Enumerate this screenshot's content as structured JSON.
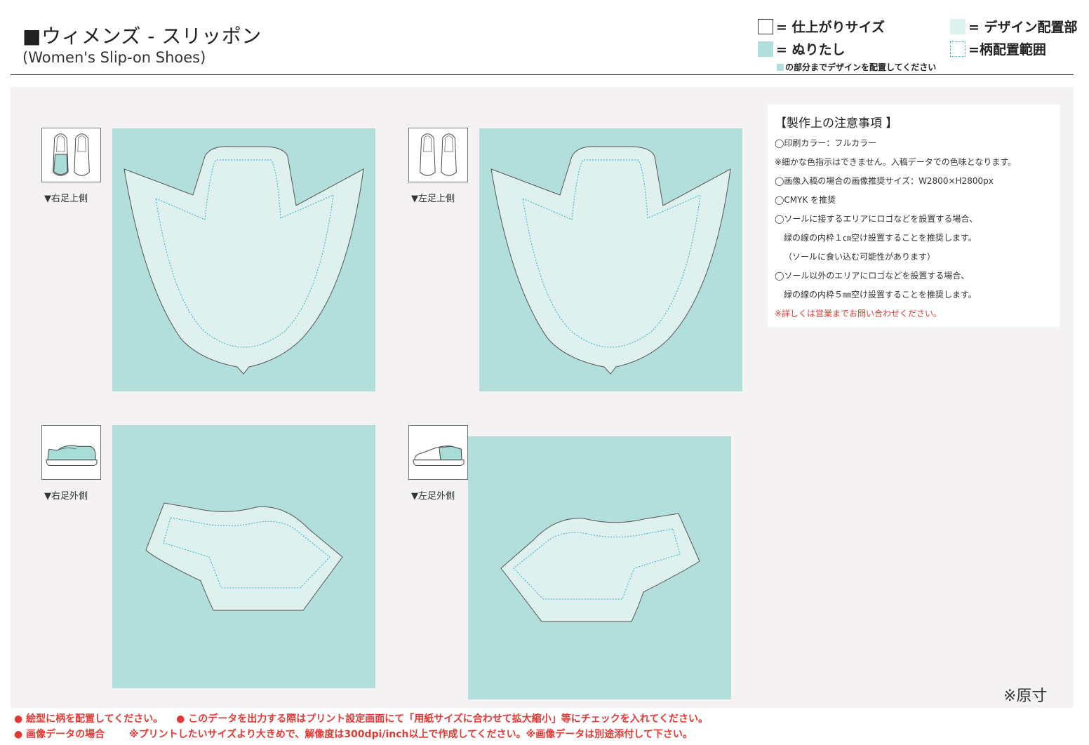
{
  "header": {
    "title": "■ウィメンズ - スリッポン",
    "subtitle": "(Women's Slip-on Shoes)"
  },
  "legend": {
    "finish_size": "= 仕上がりサイズ",
    "bleed": "= ぬりたし",
    "bleed_note": "の部分までデザインを配置してください",
    "design_area": "= デザイン配置部",
    "pattern_area": "=柄配置範囲"
  },
  "colors": {
    "bleed": "#b2dfdb",
    "design_area": "#dff1ef",
    "pattern_line": "#2ab3c7",
    "warning": "#e53935",
    "work_bg": "#f4f2f2"
  },
  "panels": [
    {
      "caption": "▼右足上側",
      "shape": "upper-right"
    },
    {
      "caption": "▼左足上側",
      "shape": "upper-left"
    },
    {
      "caption": "▼右足外側",
      "shape": "outer-right"
    },
    {
      "caption": "▼左足外側",
      "shape": "outer-left"
    }
  ],
  "notes": {
    "title": "【製作上の注意事項 】",
    "lines": [
      "◯印刷カラー：フルカラー",
      "※細かな色指示はできません。入稿データでの色味となります。",
      "◯画像入稿の場合の画像推奨サイズ：W2800×H2800px",
      "◯CMYK を推奨",
      "◯ソールに接するエリアにロゴなどを設置する場合、",
      "緑の線の内枠１㎝空け設置することを推奨します。",
      "（ソールに食い込む可能性があります）",
      "◯ソール以外のエリアにロゴなどを設置する場合、",
      "緑の線の内枠５㎜空け設置することを推奨します。",
      "※詳しくは営業までお問い合わせください。"
    ]
  },
  "scale_note": "※原寸",
  "footer": {
    "line1_a": "● 絵型に柄を配置してください。",
    "line1_b": "● このデータを出力する際はプリント設定画面にて「用紙サイズに合わせて拡大縮小」等にチェックを入れてください。",
    "line2_a": "● 画像データの場合",
    "line2_b": "※プリントしたいサイズより大きめで、解像度は300dpi/inch以上で作成してください。※画像データは別途添付して下さい。"
  }
}
